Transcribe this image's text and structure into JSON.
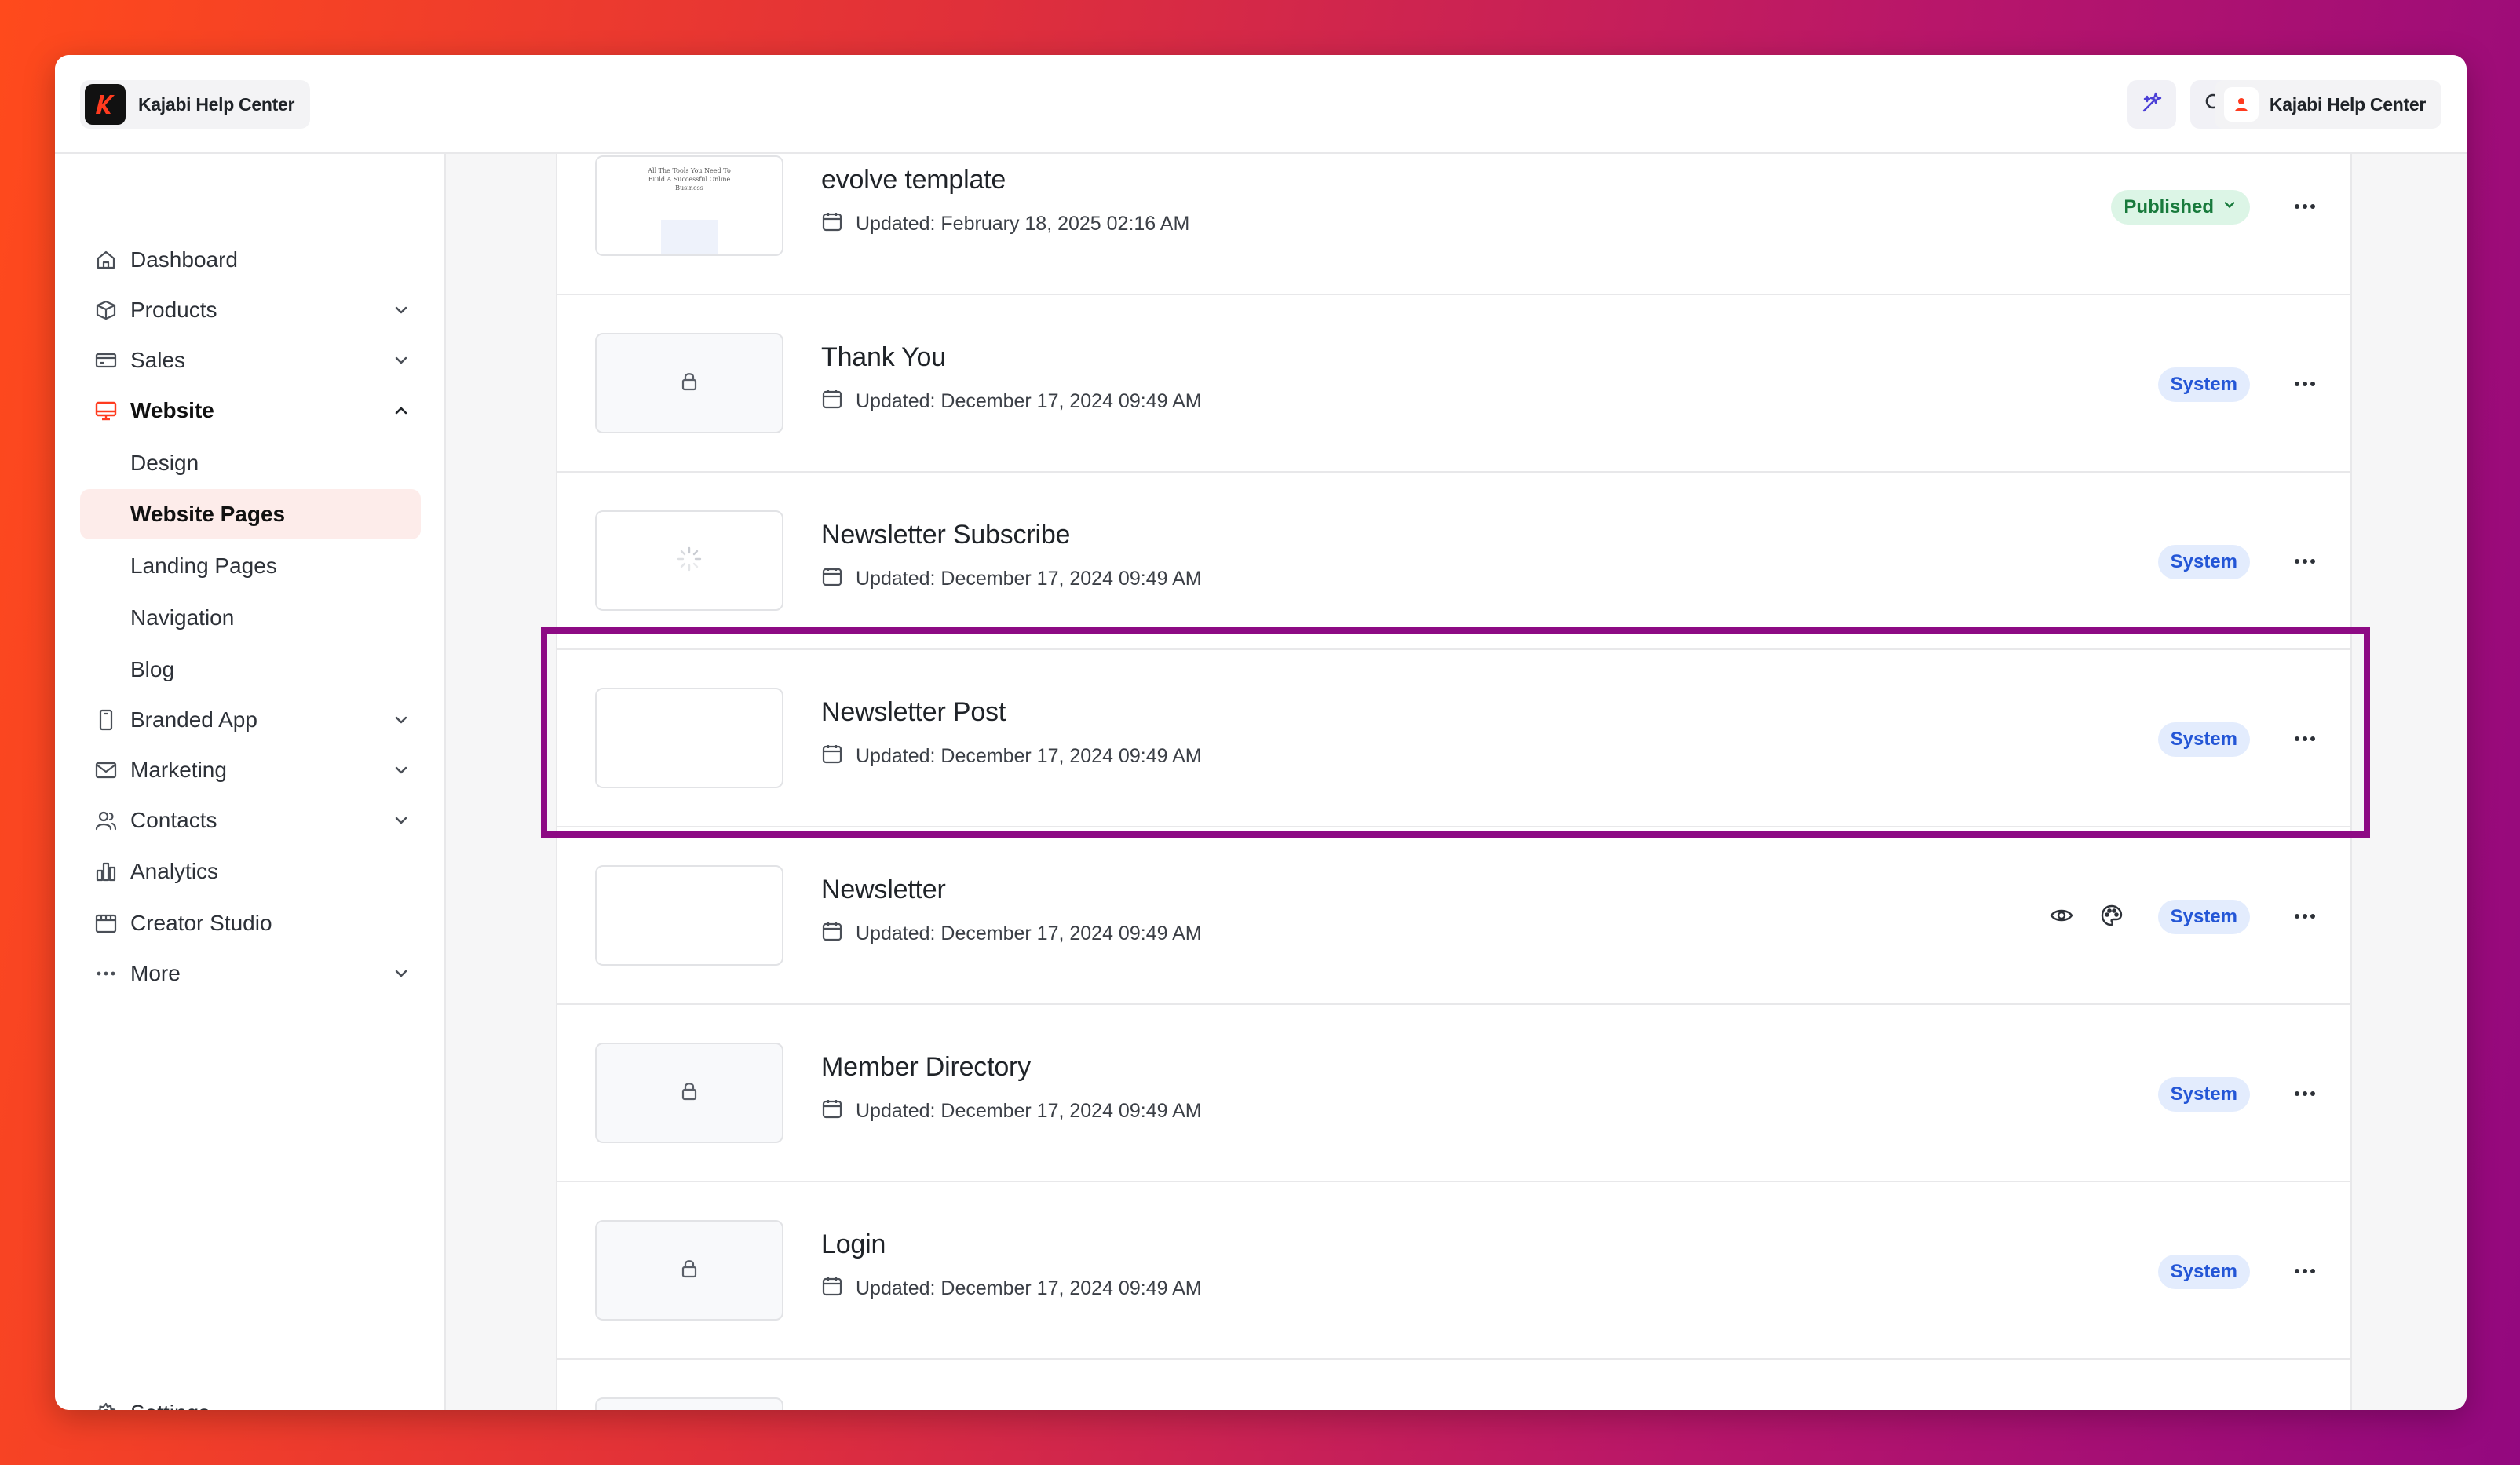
{
  "app": {
    "brand_name": "Kajabi Help Center",
    "account_name": "Kajabi Help Center"
  },
  "sidebar": {
    "items": [
      {
        "label": "Dashboard",
        "icon": "home-icon"
      },
      {
        "label": "Products",
        "icon": "box-icon",
        "expandable": true
      },
      {
        "label": "Sales",
        "icon": "credit-card-icon",
        "expandable": true
      },
      {
        "label": "Website",
        "icon": "monitor-icon",
        "expanded": true
      },
      {
        "label": "Branded App",
        "icon": "phone-icon",
        "expandable": true
      },
      {
        "label": "Marketing",
        "icon": "mail-icon",
        "expandable": true
      },
      {
        "label": "Contacts",
        "icon": "users-icon",
        "expandable": true
      },
      {
        "label": "Analytics",
        "icon": "bar-chart-icon"
      },
      {
        "label": "Creator Studio",
        "icon": "calendar-grid-icon"
      },
      {
        "label": "More",
        "icon": "dots-icon",
        "expandable": true
      }
    ],
    "website_sub": [
      "Design",
      "Website Pages",
      "Landing Pages",
      "Navigation",
      "Blog"
    ],
    "selected_sub": "Website Pages",
    "settings_label": "Settings"
  },
  "pages": [
    {
      "title": "evolve template",
      "updated": "Updated: February 18, 2025 02:16 AM",
      "status": "Published",
      "thumb": "preview",
      "thumb_text": "All The Tools You Need To Build A Successful Online Business"
    },
    {
      "title": "Thank You",
      "updated": "Updated: December 17, 2024 09:49 AM",
      "status": "System",
      "thumb": "lock"
    },
    {
      "title": "Newsletter Subscribe",
      "updated": "Updated: December 17, 2024 09:49 AM",
      "status": "System",
      "thumb": "loading"
    },
    {
      "title": "Newsletter Post",
      "updated": "Updated: December 17, 2024 09:49 AM",
      "status": "System",
      "thumb": "blank"
    },
    {
      "title": "Newsletter",
      "updated": "Updated: December 17, 2024 09:49 AM",
      "status": "System",
      "thumb": "blank"
    },
    {
      "title": "Member Directory",
      "updated": "Updated: December 17, 2024 09:49 AM",
      "status": "System",
      "thumb": "lock"
    },
    {
      "title": "Login",
      "updated": "Updated: December 17, 2024 09:49 AM",
      "status": "System",
      "thumb": "lock"
    }
  ],
  "colors": {
    "accent_highlight": "#8d0a84",
    "system_badge_bg": "#e3ecfd",
    "system_badge_text": "#2456d6",
    "published_badge_bg": "#dcf5e6",
    "published_badge_text": "#187a3c",
    "selected_nav_bg": "#fdecea",
    "brand_red": "#ff3b1f"
  }
}
